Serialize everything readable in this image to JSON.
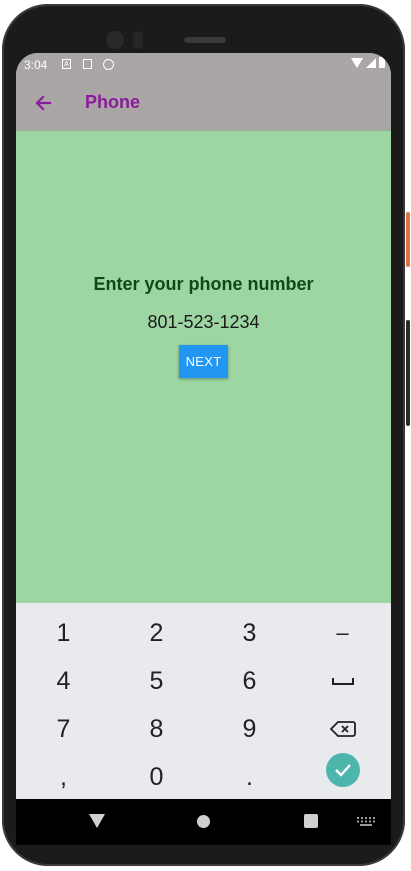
{
  "status_bar": {
    "time": "3:04"
  },
  "app_bar": {
    "title": "Phone"
  },
  "main": {
    "prompt": "Enter your phone number",
    "phone_number": "801-523-1234",
    "next_label": "NEXT"
  },
  "keyboard": {
    "keys": {
      "k1": "1",
      "k2": "2",
      "k3": "3",
      "minus": "–",
      "k4": "4",
      "k5": "5",
      "k6": "6",
      "space": "␣",
      "k7": "7",
      "k8": "8",
      "k9": "9",
      "backspace": "⌫",
      "comma": ",",
      "k0": "0",
      "period": ".",
      "done": "✓"
    }
  },
  "colors": {
    "screen_background": "#9ed6a3",
    "app_bar": "#aaa6a6",
    "title": "#8a1b9b",
    "prompt": "#0d4a14",
    "next_button": "#2196f3",
    "keyboard_bg": "#e8eaed",
    "done_key": "#4db6ac"
  }
}
